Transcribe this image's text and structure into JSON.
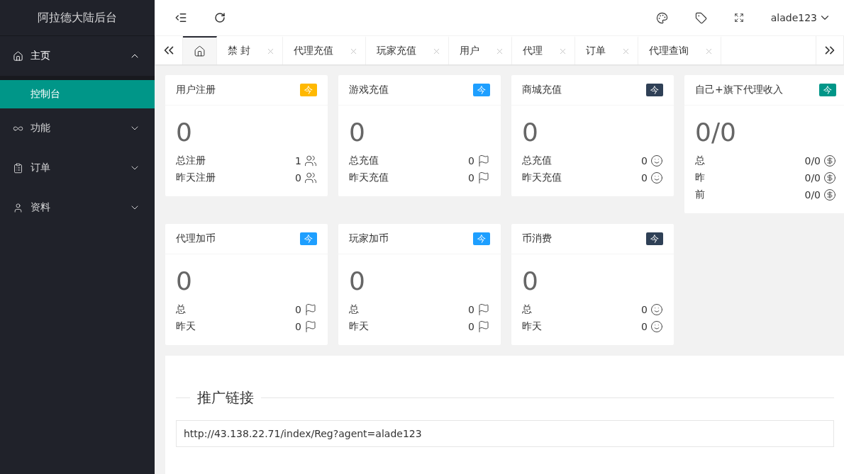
{
  "sidebar": {
    "title": "阿拉德大陆后台",
    "items": [
      {
        "label": "主页",
        "kind": "home",
        "expanded": true,
        "children": [
          {
            "label": "控制台",
            "selected": true
          }
        ]
      },
      {
        "label": "功能",
        "kind": "link",
        "expanded": false
      },
      {
        "label": "订单",
        "kind": "clipboard",
        "expanded": false
      },
      {
        "label": "资料",
        "kind": "user",
        "expanded": false
      }
    ]
  },
  "header": {
    "user": "alade123"
  },
  "tabs": [
    {
      "kind": "home",
      "selected": true
    },
    {
      "label": "禁 封",
      "selected": false
    },
    {
      "label": "代理充值",
      "selected": false
    },
    {
      "label": "玩家充值",
      "selected": false
    },
    {
      "label": "用户",
      "selected": false
    },
    {
      "label": "代理",
      "selected": false
    },
    {
      "label": "订单",
      "selected": false
    },
    {
      "label": "代理查询",
      "selected": false
    }
  ],
  "cards": [
    {
      "title": "用户注册",
      "badge": "今",
      "color": "#ffb800",
      "value": "0",
      "kind": "users",
      "rows": [
        {
          "label": "总注册",
          "value": "1"
        },
        {
          "label": "昨天注册",
          "value": "0"
        }
      ]
    },
    {
      "title": "游戏充值",
      "badge": "今",
      "color": "#1e9fff",
      "value": "0",
      "kind": "flag",
      "rows": [
        {
          "label": "总充值",
          "value": "0"
        },
        {
          "label": "昨天充值",
          "value": "0"
        }
      ]
    },
    {
      "title": "商城充值",
      "badge": "今",
      "color": "#2f4056",
      "value": "0",
      "kind": "smile",
      "rows": [
        {
          "label": "总充值",
          "value": "0"
        },
        {
          "label": "昨天充值",
          "value": "0"
        }
      ]
    },
    {
      "title": "自己+旗下代理收入",
      "badge": "今",
      "color": "#009688",
      "value": "0/0",
      "kind": "dollar",
      "rows": [
        {
          "label": "总",
          "value": "0/0"
        },
        {
          "label": "昨",
          "value": "0/0"
        },
        {
          "label": "前",
          "value": "0/0"
        }
      ]
    },
    {
      "title": "代理加币",
      "badge": "今",
      "color": "#1e9fff",
      "value": "0",
      "kind": "flag",
      "rows": [
        {
          "label": "总",
          "value": "0"
        },
        {
          "label": "昨天",
          "value": "0"
        }
      ]
    },
    {
      "title": "玩家加币",
      "badge": "今",
      "color": "#1e9fff",
      "value": "0",
      "kind": "flag",
      "rows": [
        {
          "label": "总",
          "value": "0"
        },
        {
          "label": "昨天",
          "value": "0"
        }
      ]
    },
    {
      "title": "币消费",
      "badge": "今",
      "color": "#2f4056",
      "value": "0",
      "kind": "smile",
      "rows": [
        {
          "label": "总",
          "value": "0"
        },
        {
          "label": "昨天",
          "value": "0"
        }
      ]
    }
  ],
  "promo": {
    "legend": "推广链接",
    "value": "http://43.138.22.71/index/Reg?agent=alade123"
  }
}
